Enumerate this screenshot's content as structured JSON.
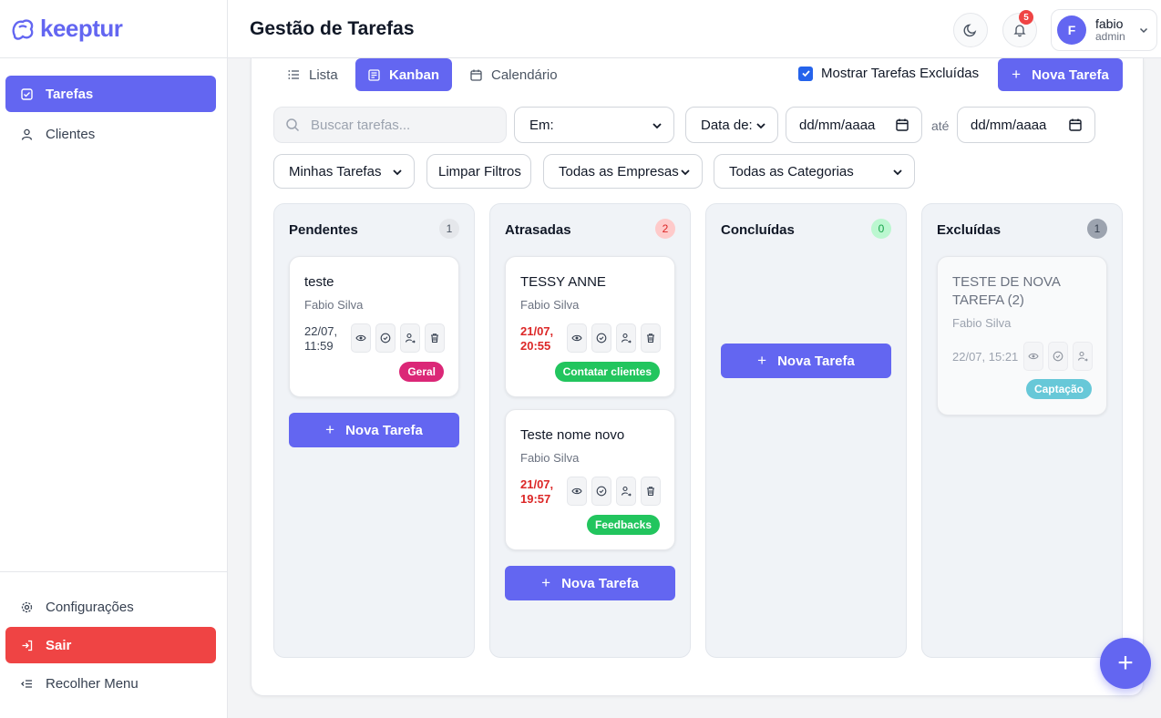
{
  "brand": {
    "name": "keeptur",
    "color": "#6366f1"
  },
  "sidebar": {
    "items": [
      {
        "label": "Tarefas",
        "icon": "checkbox-icon",
        "active": true
      },
      {
        "label": "Clientes",
        "icon": "user-icon",
        "active": false
      }
    ],
    "bottom": [
      {
        "label": "Configurações",
        "icon": "gear-icon"
      },
      {
        "label": "Sair",
        "icon": "logout-icon"
      },
      {
        "label": "Recolher Menu",
        "icon": "collapse-menu-icon"
      }
    ]
  },
  "header": {
    "title": "Gestão de Tarefas",
    "notifications": "5",
    "user": {
      "initial": "F",
      "name": "fabio",
      "role": "admin"
    }
  },
  "toolbar": {
    "views": [
      {
        "label": "Lista",
        "icon": "list-icon"
      },
      {
        "label": "Kanban",
        "icon": "kanban-icon",
        "active": true
      },
      {
        "label": "Calendário",
        "icon": "calendar-icon"
      }
    ],
    "show_deleted_label": "Mostrar Tarefas Excluídas",
    "show_deleted_checked": true,
    "new_task_label": "Nova Tarefa"
  },
  "filters": {
    "search_placeholder": "Buscar tarefas...",
    "em": "Em:",
    "data_de": "Data de:",
    "date_from": "dd/mm/aaaa",
    "ate": "até",
    "date_to": "dd/mm/aaaa",
    "mine": "Minhas Tarefas",
    "clear": "Limpar Filtros",
    "companies": "Todas as Empresas",
    "categories": "Todas as Categorias"
  },
  "columns": [
    {
      "title": "Pendentes",
      "count": "1",
      "cards": [
        {
          "title": "teste",
          "owner": "Fabio Silva",
          "date": "22/07,",
          "time": "11:59",
          "tag": "Geral",
          "tag_color": "#db2777"
        }
      ],
      "new_label": "Nova Tarefa"
    },
    {
      "title": "Atrasadas",
      "count": "2",
      "cards": [
        {
          "title": "TESSY ANNE",
          "owner": "Fabio Silva",
          "date": "21/07,",
          "time": "20:55",
          "tag": "Contatar clientes",
          "tag_color": "#22c55e"
        },
        {
          "title": "Teste nome novo",
          "owner": "Fabio Silva",
          "date": "21/07,",
          "time": "19:57",
          "tag": "Feedbacks",
          "tag_color": "#22c55e"
        }
      ],
      "new_label": "Nova Tarefa"
    },
    {
      "title": "Concluídas",
      "count": "0",
      "cards": [],
      "new_label": "Nova Tarefa"
    },
    {
      "title": "Excluídas",
      "count": "1",
      "cards": [
        {
          "title": "TESTE DE NOVA TAREFA (2)",
          "owner": "Fabio Silva",
          "date": "22/07, 15:21",
          "tag": "Captação",
          "tag_color": "#67c8d8"
        }
      ]
    }
  ],
  "fab_label": "+"
}
